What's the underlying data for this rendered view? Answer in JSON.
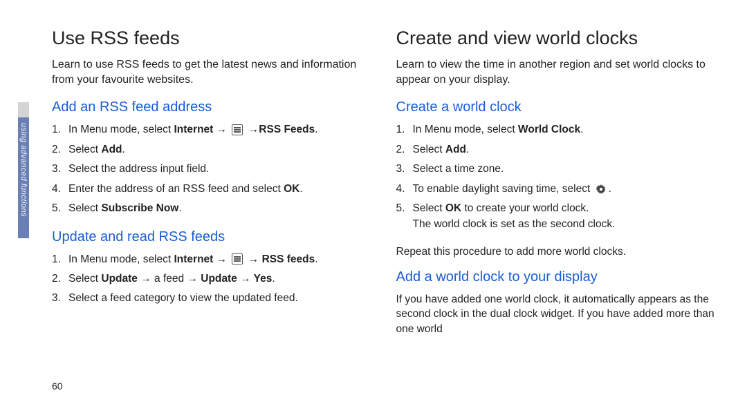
{
  "sideLabel": "using advanced functions",
  "pageNumber": "60",
  "left": {
    "heading": "Use RSS feeds",
    "intro": "Learn to use RSS feeds to get the latest news and information from your favourite websites.",
    "section1": {
      "title": "Add an RSS feed address",
      "steps": {
        "s1_pre": "In Menu mode, select ",
        "s1_b1": "Internet →",
        "s1_post": " →",
        "s1_b2": "RSS Feeds",
        "s1_end": ".",
        "s2_pre": "Select ",
        "s2_b": "Add",
        "s2_end": ".",
        "s3": "Select the address input field.",
        "s4_pre": "Enter the address of an RSS feed and select ",
        "s4_b": "OK",
        "s4_end": ".",
        "s5_pre": "Select ",
        "s5_b": "Subscribe Now",
        "s5_end": "."
      }
    },
    "section2": {
      "title": "Update and read RSS feeds",
      "steps": {
        "s1_pre": "In Menu mode, select ",
        "s1_b1": "Internet →",
        "s1_mid": " → ",
        "s1_b2": "RSS feeds",
        "s1_end": ".",
        "s2_pre": "Select ",
        "s2_b1": "Update →",
        "s2_mid1": " a feed ",
        "s2_b2": "→ Update → Yes",
        "s2_end": ".",
        "s3": "Select a feed category to view the updated feed."
      }
    }
  },
  "right": {
    "heading": "Create and view world clocks",
    "intro": "Learn to view the time in another region and set world clocks to appear on your display.",
    "section1": {
      "title": "Create a world clock",
      "steps": {
        "s1_pre": "In Menu mode, select ",
        "s1_b": "World Clock",
        "s1_end": ".",
        "s2_pre": "Select ",
        "s2_b": "Add",
        "s2_end": ".",
        "s3": "Select a time zone.",
        "s4": "To enable daylight saving time, select ",
        "s4_end": ".",
        "s5_pre": "Select ",
        "s5_b": "OK",
        "s5_mid": " to create your world clock.",
        "s5_line2": "The world clock is set as the second clock."
      },
      "after": "Repeat this procedure to add more world clocks."
    },
    "section2": {
      "title": "Add a world clock to your display",
      "para": "If you have added one world clock, it automatically appears as the second clock in the dual clock widget. If you have added more than one world"
    }
  }
}
